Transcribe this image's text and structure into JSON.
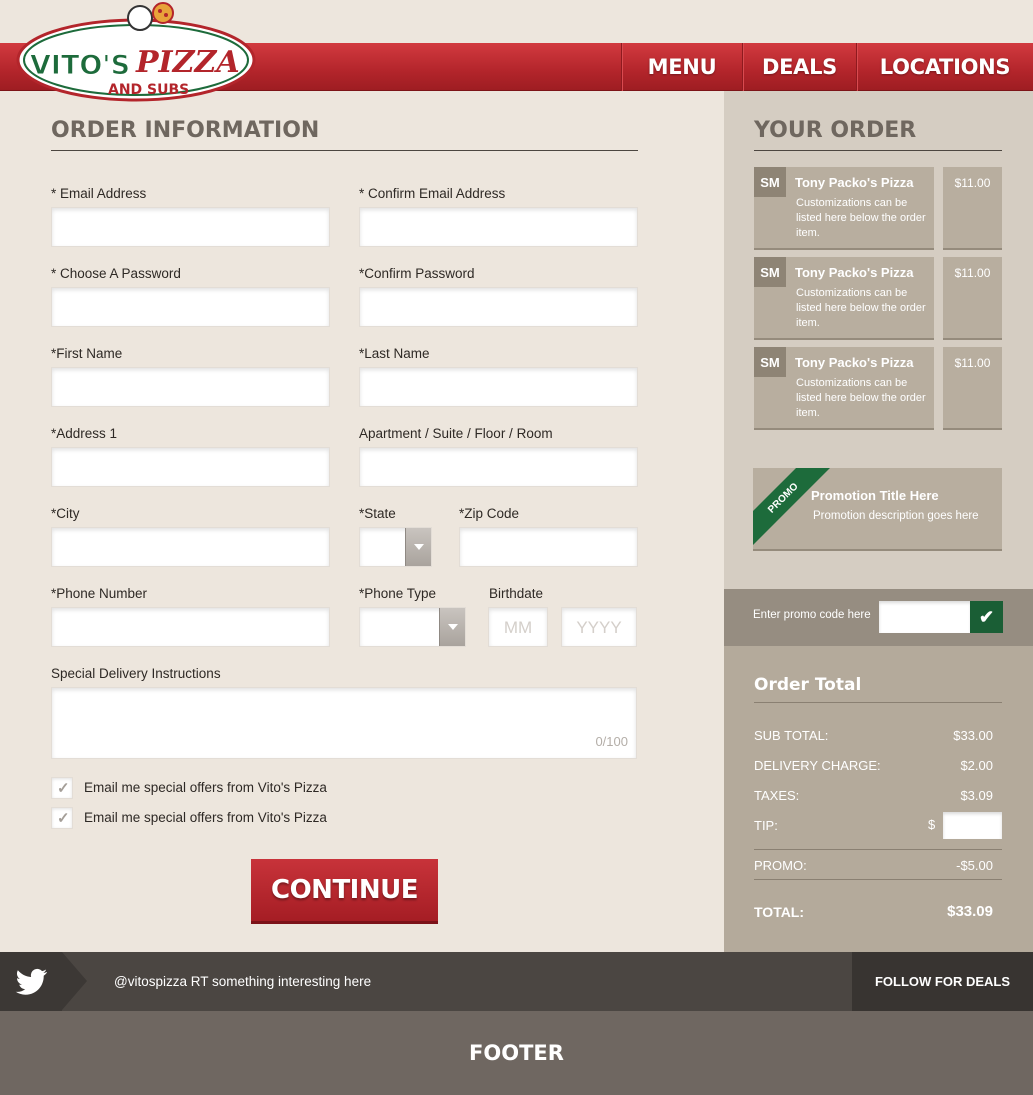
{
  "brand": {
    "name": "VITO'S PIZZA AND SUBS",
    "logo_text_1": "VITO'S",
    "logo_text_2": "PIZZA",
    "logo_text_3": "AND SUBS"
  },
  "nav": {
    "menu": "MENU",
    "deals": "DEALS",
    "locations": "LOCATIONS"
  },
  "form": {
    "heading": "ORDER INFORMATION",
    "email_label": "* Email Address",
    "confirm_email_label": "* Confirm Email Address",
    "password_label": "* Choose A Password",
    "confirm_password_label": "*Confirm Password",
    "first_name_label": "*First Name",
    "last_name_label": "*Last Name",
    "address1_label": "*Address 1",
    "apartment_label": "Apartment / Suite / Floor / Room",
    "city_label": "*City",
    "state_label": "*State",
    "zip_label": "*Zip Code",
    "phone_label": "*Phone Number",
    "phone_type_label": "*Phone Type",
    "birthdate_label": "Birthdate",
    "birth_month_placeholder": "MM",
    "birth_year_placeholder": "YYYY",
    "instructions_label": "Special Delivery Instructions",
    "instructions_counter": "0/100",
    "offers_1": "Email me special offers from Vito's Pizza",
    "offers_2": "Email me special offers from Vito's Pizza",
    "continue": "CONTINUE"
  },
  "order": {
    "heading": "YOUR ORDER",
    "items": [
      {
        "size": "SM",
        "name": "Tony Packo's Pizza",
        "desc": "Customizations can be listed here below the order item.",
        "price": "$11.00"
      },
      {
        "size": "SM",
        "name": "Tony Packo's Pizza",
        "desc": "Customizations can be listed here below the order item.",
        "price": "$11.00"
      },
      {
        "size": "SM",
        "name": "Tony Packo's Pizza",
        "desc": "Customizations can be listed here below the order item.",
        "price": "$11.00"
      }
    ],
    "promo_badge": "PROMO",
    "promo_title": "Promotion Title Here",
    "promo_desc": "Promotion description goes here",
    "promo_code_label": "Enter promo code here",
    "total_heading": "Order Total",
    "subtotal_label": "SUB TOTAL:",
    "subtotal": "$33.00",
    "delivery_label": "DELIVERY CHARGE:",
    "delivery": "$2.00",
    "taxes_label": "TAXES:",
    "taxes": "$3.09",
    "tip_label": "TIP:",
    "tip_currency": "$",
    "promo_label": "PROMO:",
    "promo": "-$5.00",
    "total_label": "TOTAL:",
    "total": "$33.09"
  },
  "twitter": {
    "text": "@vitospizza RT something interesting here",
    "follow": "FOLLOW FOR DEALS"
  },
  "footer": {
    "text": "FOOTER"
  },
  "colors": {
    "brand_red": "#b3252b",
    "promo_green": "#1d6b3b",
    "sidebar": "#d5cdc2",
    "total_panel": "#b4aa9b"
  }
}
